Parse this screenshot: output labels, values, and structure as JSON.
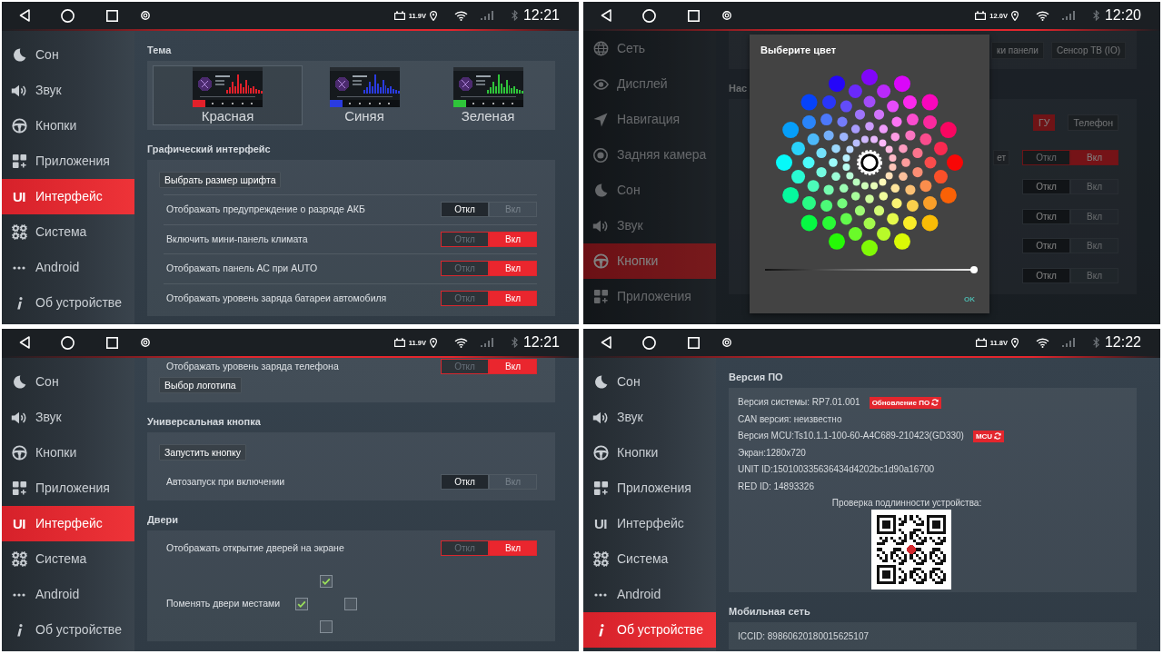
{
  "panels": [
    {
      "status_bar": {
        "voltage": "11.9V",
        "time": "12:21"
      },
      "sidebar": {
        "items": [
          {
            "kind": "sleep",
            "label": "Сон",
            "selected": false
          },
          {
            "kind": "sound",
            "label": "Звук",
            "selected": false
          },
          {
            "kind": "buttons",
            "label": "Кнопки",
            "selected": false
          },
          {
            "kind": "apps",
            "label": "Приложения",
            "selected": false
          },
          {
            "kind": "interface",
            "glyph": "UI",
            "label": "Интерфейс",
            "selected": true
          },
          {
            "kind": "system",
            "label": "Система",
            "selected": false
          },
          {
            "kind": "android",
            "label": "Android",
            "selected": false
          },
          {
            "kind": "about",
            "label": "Об устройстве",
            "selected": false
          }
        ]
      },
      "sections": [
        {
          "title": "Тема",
          "items": [
            {
              "kind": "themes",
              "options": [
                {
                  "label": "Красная",
                  "color": "#e3202a",
                  "selected": true
                },
                {
                  "label": "Синяя",
                  "color": "#2a3be0",
                  "selected": false
                },
                {
                  "label": "Зеленая",
                  "color": "#2fc53a",
                  "selected": false
                }
              ]
            }
          ]
        },
        {
          "title": "Графический интерфейс",
          "dividers": true,
          "items": [
            {
              "kind": "button",
              "label": "Выбрать размер шрифта"
            },
            {
              "kind": "toggle",
              "label": "Отображать предупреждение о разряде АКБ",
              "options": [
                {
                  "label": "Откл",
                  "selected": true
                },
                {
                  "label": "Вкл",
                  "selected": false
                }
              ]
            },
            {
              "kind": "toggle",
              "label": "Включить мини-панель климата",
              "options": [
                {
                  "label": "Откл",
                  "selected": false
                },
                {
                  "label": "Вкл",
                  "selected": true
                }
              ]
            },
            {
              "kind": "toggle",
              "label": "Отображать панель АС при AUTO",
              "options": [
                {
                  "label": "Откл",
                  "selected": false
                },
                {
                  "label": "Вкл",
                  "selected": true
                }
              ]
            },
            {
              "kind": "toggle",
              "label": "Отображать уровень заряда батареи автомобиля",
              "options": [
                {
                  "label": "Откл",
                  "selected": false
                },
                {
                  "label": "Вкл",
                  "selected": true
                }
              ]
            }
          ]
        }
      ]
    },
    {
      "status_bar": {
        "voltage": "12.0V",
        "time": "12:20"
      },
      "sidebar": {
        "items": [
          {
            "kind": "network",
            "label": "Сеть",
            "selected": false
          },
          {
            "kind": "display",
            "label": "Дисплей",
            "selected": false
          },
          {
            "kind": "navigation",
            "label": "Навигация",
            "selected": false
          },
          {
            "kind": "camera",
            "label": "Задняя камера",
            "selected": false
          },
          {
            "kind": "sleep",
            "label": "Сон",
            "selected": false
          },
          {
            "kind": "sound",
            "label": "Звук",
            "selected": false
          },
          {
            "kind": "buttons",
            "label": "Кнопки",
            "selected": true
          },
          {
            "kind": "apps",
            "label": "Приложения",
            "selected": false
          }
        ]
      },
      "sections": [
        {
          "items": [
            {
              "kind": "button_row",
              "buttons": [
                {
                  "label": "ки панели"
                },
                {
                  "label": "Сенсор ТВ (IO)"
                }
              ]
            }
          ]
        },
        {
          "title": "Нас",
          "items": [
            {
              "kind": "choice",
              "options": [
                {
                  "label": "ГУ",
                  "selected": true
                },
                {
                  "label": "Телефон",
                  "selected": false
                }
              ]
            },
            {
              "kind": "toggle",
              "fragment": "ет",
              "options": [
                {
                  "label": "Откл",
                  "selected": false
                },
                {
                  "label": "Вкл",
                  "selected": true
                }
              ]
            },
            {
              "kind": "toggle",
              "options": [
                {
                  "label": "Откл",
                  "selected": true
                },
                {
                  "label": "Вкл",
                  "selected": false
                }
              ]
            },
            {
              "kind": "toggle",
              "options": [
                {
                  "label": "Откл",
                  "selected": true
                },
                {
                  "label": "Вкл",
                  "selected": false
                }
              ]
            },
            {
              "kind": "toggle",
              "options": [
                {
                  "label": "Откл",
                  "selected": true
                },
                {
                  "label": "Вкл",
                  "selected": false
                }
              ]
            },
            {
              "kind": "toggle",
              "options": [
                {
                  "label": "Откл",
                  "selected": true
                },
                {
                  "label": "Вкл",
                  "selected": false
                }
              ]
            }
          ]
        }
      ],
      "dialog": {
        "title": "Выберите цвет",
        "slider": {
          "level": 1
        },
        "button": "OK"
      }
    },
    {
      "status_bar": {
        "voltage": "11.9V",
        "time": "12:21"
      },
      "sidebar": {
        "items": [
          {
            "kind": "sleep",
            "label": "Сон",
            "selected": false
          },
          {
            "kind": "sound",
            "label": "Звук",
            "selected": false
          },
          {
            "kind": "buttons",
            "label": "Кнопки",
            "selected": false
          },
          {
            "kind": "apps",
            "label": "Приложения",
            "selected": false
          },
          {
            "kind": "interface",
            "glyph": "UI",
            "label": "Интерфейс",
            "selected": true
          },
          {
            "kind": "system",
            "label": "Система",
            "selected": false
          },
          {
            "kind": "android",
            "label": "Android",
            "selected": false
          },
          {
            "kind": "about",
            "label": "Об устройстве",
            "selected": false
          }
        ]
      },
      "sections": [
        {
          "items": [
            {
              "kind": "toggle",
              "label": "Отображать уровень заряда телефона",
              "options": [
                {
                  "label": "Откл",
                  "selected": false
                },
                {
                  "label": "Вкл",
                  "selected": true
                }
              ]
            },
            {
              "kind": "button",
              "label": "Выбор логотипа"
            }
          ]
        },
        {
          "title": "Универсальная кнопка",
          "items": [
            {
              "kind": "button",
              "label": "Запустить кнопку"
            },
            {
              "kind": "toggle",
              "label": "Автозапуск при включении",
              "options": [
                {
                  "label": "Откл",
                  "selected": true
                },
                {
                  "label": "Вкл",
                  "selected": false
                }
              ]
            }
          ]
        },
        {
          "title": "Двери",
          "items": [
            {
              "kind": "toggle",
              "label": "Отображать открытие дверей на экране",
              "options": [
                {
                  "label": "Откл",
                  "selected": false
                },
                {
                  "label": "Вкл",
                  "selected": true
                }
              ]
            },
            {
              "kind": "doors",
              "label": "Поменять двери местами",
              "checks": [
                {
                  "checked": true
                },
                {
                  "checked": true
                },
                {
                  "checked": false
                },
                {
                  "checked": false
                }
              ]
            }
          ]
        }
      ]
    },
    {
      "status_bar": {
        "voltage": "11.8V",
        "time": "12:22"
      },
      "sidebar": {
        "items": [
          {
            "kind": "sleep",
            "label": "Сон",
            "selected": false
          },
          {
            "kind": "sound",
            "label": "Звук",
            "selected": false
          },
          {
            "kind": "buttons",
            "label": "Кнопки",
            "selected": false
          },
          {
            "kind": "apps",
            "label": "Приложения",
            "selected": false
          },
          {
            "kind": "interface",
            "glyph": "UI",
            "label": "Интерфейс",
            "selected": false
          },
          {
            "kind": "system",
            "label": "Система",
            "selected": false
          },
          {
            "kind": "android",
            "label": "Android",
            "selected": false
          },
          {
            "kind": "about",
            "label": "Об устройстве",
            "selected": true
          }
        ]
      },
      "sections": [
        {
          "title": "Версия ПО",
          "items": [
            {
              "kind": "info",
              "text": "Версия системы: RP7.01.001",
              "action": "Обновление ПО"
            },
            {
              "kind": "info",
              "text": "CAN версия: неизвестно"
            },
            {
              "kind": "info",
              "text": "Версия MCU:Ts10.1.1-100-60-A4C689-210423(GD330)",
              "action": "MCU"
            },
            {
              "kind": "info",
              "text": "Экран:1280x720"
            },
            {
              "kind": "info",
              "text": "UNIT ID:150100335636434d4202bc1d90a16700"
            },
            {
              "kind": "info",
              "text": "RED ID: 14893326"
            },
            {
              "kind": "caption",
              "text": "Проверка подлинности устройства:"
            },
            {
              "kind": "qr"
            }
          ]
        },
        {
          "title": "Мобильная сеть",
          "items": [
            {
              "kind": "info",
              "text": "ICCID: 89860620180015625107"
            }
          ]
        }
      ]
    }
  ]
}
